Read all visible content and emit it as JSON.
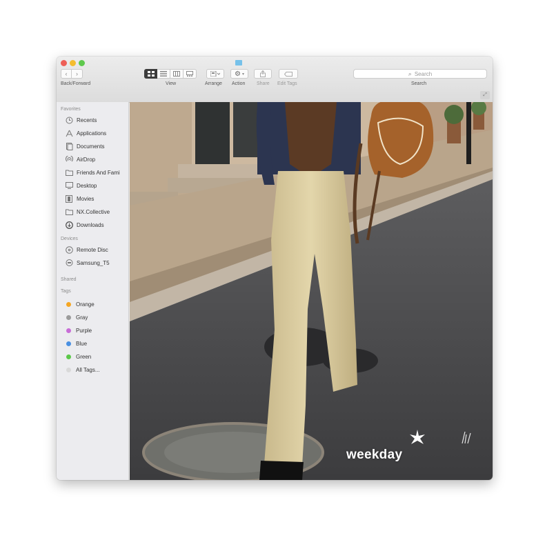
{
  "toolbar": {
    "nav_label": "Back/Forward",
    "view_label": "View",
    "arrange_label": "Arrange",
    "action_label": "Action",
    "share_label": "Share",
    "edit_tags_label": "Edit Tags",
    "search_label": "Search",
    "search_placeholder": "Search",
    "back_icon": "chevron-left-icon",
    "forward_icon": "chevron-right-icon"
  },
  "sidebar": {
    "favorites_header": "Favorites",
    "favorites": [
      {
        "label": "Recents",
        "icon": "clock-icon"
      },
      {
        "label": "Applications",
        "icon": "applications-icon"
      },
      {
        "label": "Documents",
        "icon": "documents-icon"
      },
      {
        "label": "AirDrop",
        "icon": "airdrop-icon"
      },
      {
        "label": "Friends And Fami",
        "icon": "folder-icon"
      },
      {
        "label": "Desktop",
        "icon": "desktop-icon"
      },
      {
        "label": "Movies",
        "icon": "movies-icon"
      },
      {
        "label": "NX.Collective",
        "icon": "folder-icon"
      },
      {
        "label": "Downloads",
        "icon": "downloads-icon"
      }
    ],
    "devices_header": "Devices",
    "devices": [
      {
        "label": "Remote Disc",
        "icon": "disc-icon"
      },
      {
        "label": "Samsung_T5",
        "icon": "drive-icon"
      }
    ],
    "shared_header": "Shared",
    "tags_header": "Tags",
    "tags": [
      {
        "label": "Orange",
        "color": "#f5a623"
      },
      {
        "label": "Gray",
        "color": "#9b9b9b"
      },
      {
        "label": "Purple",
        "color": "#c86dd7"
      },
      {
        "label": "Blue",
        "color": "#4a90e2"
      },
      {
        "label": "Green",
        "color": "#5cc84a"
      },
      {
        "label": "All Tags...",
        "color": "#d9d9d9"
      }
    ]
  },
  "content": {
    "watermark": "weekday"
  }
}
